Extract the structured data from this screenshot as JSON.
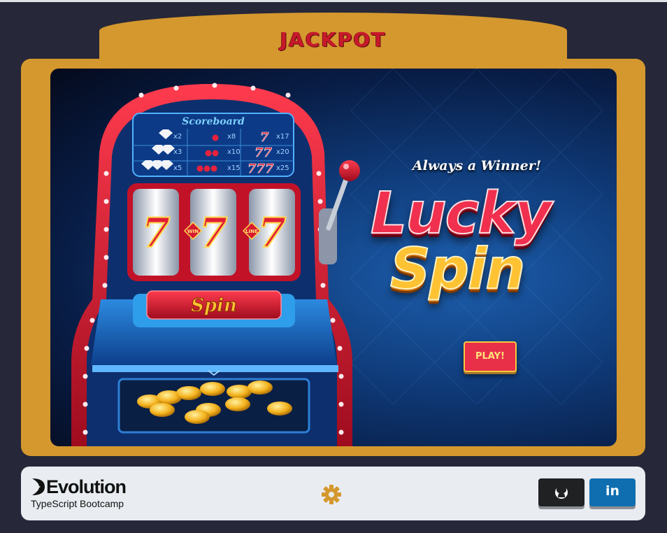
{
  "header": {
    "title": "JACKPOT"
  },
  "game": {
    "scoreboard": {
      "title": "Scoreboard",
      "rows": [
        [
          "x2",
          "x8",
          "x17"
        ],
        [
          "x3",
          "x10",
          "x20"
        ],
        [
          "x5",
          "x15",
          "x25"
        ]
      ]
    },
    "reels": [
      "7",
      "7",
      "7"
    ],
    "reel_badges": [
      "WIN",
      "LINE"
    ],
    "spin_label": "Spin",
    "tagline": "Always a Winner!",
    "logo_line1": "Lucky",
    "logo_line2": "Spin",
    "play_label": "PLAY!"
  },
  "footer": {
    "brand_name": "Evolution",
    "brand_sub": "TypeScript Bootcamp",
    "linkedin_label": "in",
    "icons": [
      "settings-icon",
      "github-icon",
      "linkedin-icon"
    ]
  },
  "colors": {
    "background": "#262738",
    "frame": "#d4982e",
    "title": "#c8192b",
    "play": "#e83049",
    "linkedin": "#0f6eb0",
    "github": "#1f2123"
  }
}
